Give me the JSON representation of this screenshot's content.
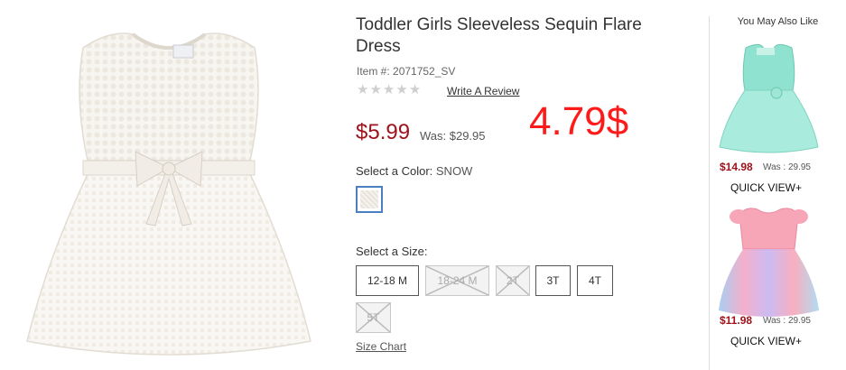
{
  "product": {
    "title": "Toddler Girls Sleeveless Sequin Flare Dress",
    "item_number": "Item #: 2071752_SV",
    "rating_stars": 0,
    "write_review": "Write A Review",
    "price": "$5.99",
    "was_price": "Was: $29.95",
    "overlay_price": "4.79$",
    "color_label": "Select a Color:",
    "color_value": "SNOW",
    "size_label": "Select a Size:",
    "sizes": [
      {
        "label": "12-18 M",
        "available": true
      },
      {
        "label": "18-24 M",
        "available": false
      },
      {
        "label": "2T",
        "available": false
      },
      {
        "label": "3T",
        "available": true
      },
      {
        "label": "4T",
        "available": true
      },
      {
        "label": "5T",
        "available": false
      }
    ],
    "size_chart": "Size Chart"
  },
  "recommendations": {
    "title": "You May Also Like",
    "items": [
      {
        "price": "$14.98",
        "was": "Was : 29.95",
        "quick_view": "QUICK VIEW+",
        "color": "#7fd9c4"
      },
      {
        "price": "$11.98",
        "was": "Was : 29.95",
        "quick_view": "QUICK VIEW+",
        "color": "#f7a6b8"
      }
    ]
  }
}
